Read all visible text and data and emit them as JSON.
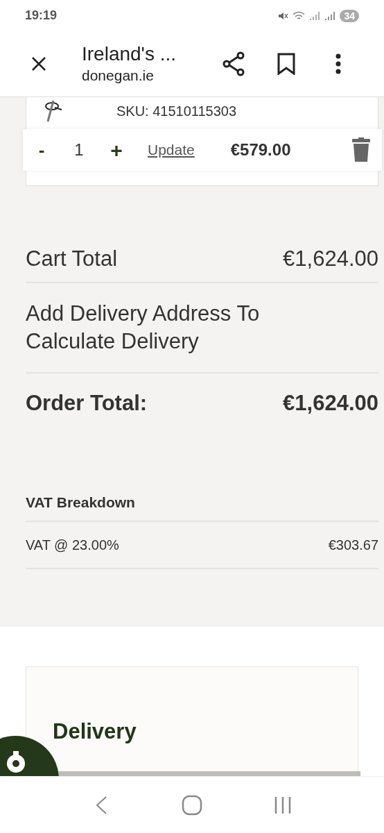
{
  "status_bar": {
    "time": "19:19",
    "battery": "34"
  },
  "toolbar": {
    "title": "Ireland's ...",
    "url": "donegan.ie"
  },
  "cart_item": {
    "sku": "SKU: 41510115303",
    "minus": "-",
    "quantity": "1",
    "plus": "+",
    "update": "Update",
    "price": "€579.00"
  },
  "totals": {
    "cart_total_label": "Cart Total",
    "cart_total": "€1,624.00",
    "delivery_note": "Add Delivery Address To Calculate Delivery",
    "order_total_label": "Order Total:",
    "order_total": "€1,624.00"
  },
  "vat": {
    "title": "VAT Breakdown",
    "rows": [
      {
        "label": "VAT @ 23.00%",
        "amount": "€303.67"
      }
    ]
  },
  "delivery": {
    "title": "Delivery"
  }
}
